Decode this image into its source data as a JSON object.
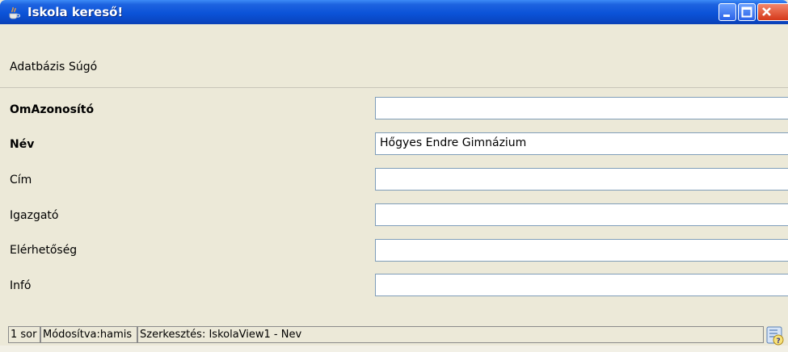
{
  "window": {
    "title": "Iskola kereső!",
    "app_icon": "java-cup-icon",
    "controls": [
      "minimize-icon",
      "maximize-icon",
      "close-icon"
    ]
  },
  "menu": {
    "items": [
      {
        "label": "Adatbázis"
      },
      {
        "label": "Súgó"
      }
    ]
  },
  "form": {
    "fields": [
      {
        "label": "OmAzonosító",
        "value": ""
      },
      {
        "label": "Név",
        "value": "Hőgyes Endre Gimnázium"
      },
      {
        "label": "Cím",
        "value": ""
      },
      {
        "label": "Igazgató",
        "value": ""
      },
      {
        "label": "Elérhetőség",
        "value": ""
      },
      {
        "label": "Infó",
        "value": ""
      }
    ]
  },
  "status": {
    "rows": "1 sor",
    "modified": "Módosítva:hamis",
    "editing": "Szerkesztés: IskolaView1 - Nev",
    "help_icon": "help-icon"
  },
  "colors": {
    "titlebar": "#0a53d8",
    "window_bg": "#ece9d8",
    "field_border": "#7f9db9"
  }
}
